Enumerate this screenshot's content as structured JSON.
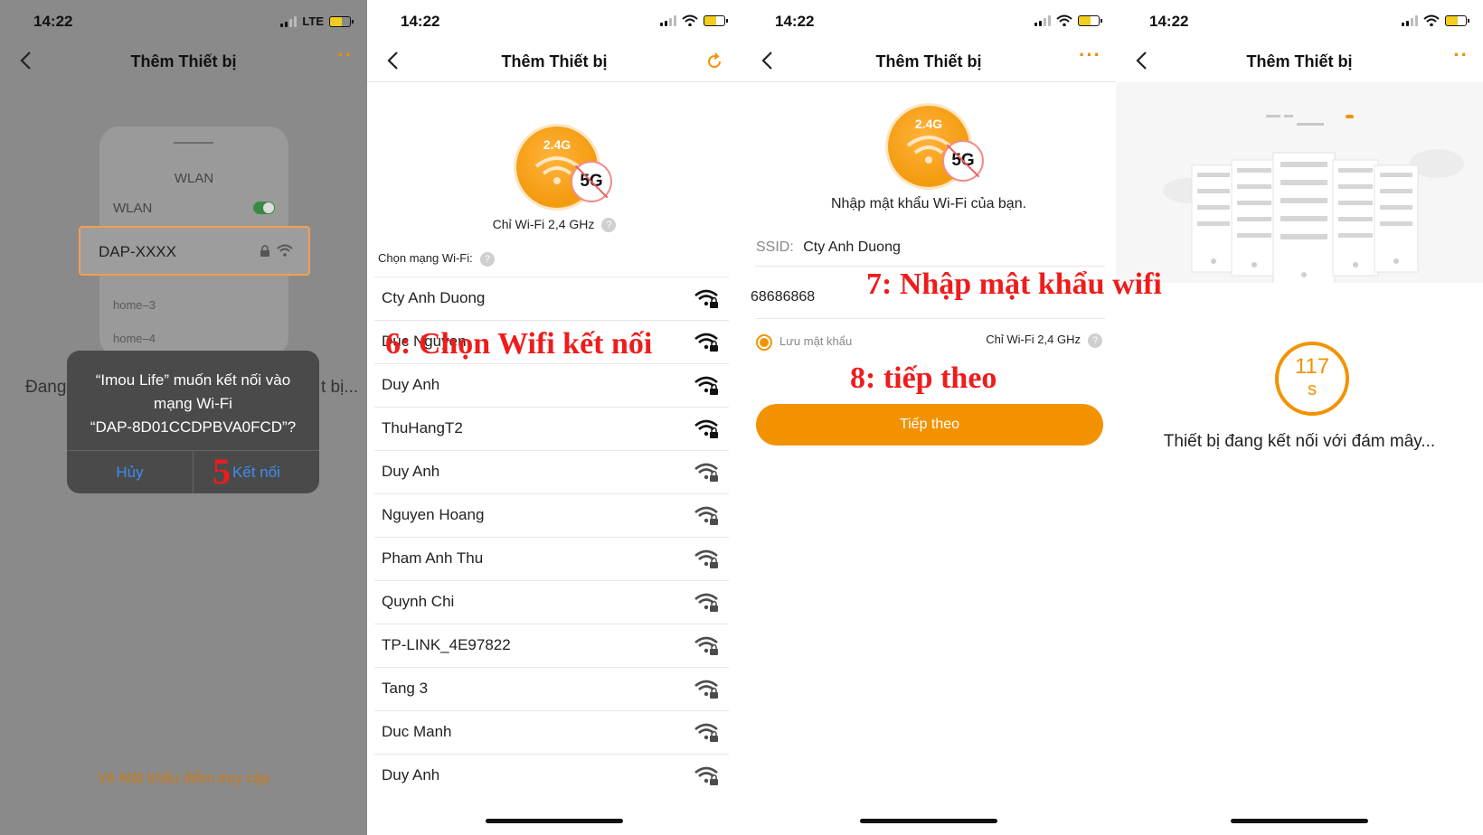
{
  "status_bar": {
    "time": "14:22",
    "carrier": "LTE"
  },
  "header": {
    "title": "Thêm Thiết bị"
  },
  "panel1": {
    "card_title": "WLAN",
    "wlan_label": "WLAN",
    "selected_network": "DAP-XXXX",
    "other_networks": [
      "home–3",
      "home–4"
    ],
    "partial_left": "Đang",
    "partial_right": "t bị...",
    "dialog": {
      "message_line1": "“Imou Life” muốn kết nối vào",
      "message_line2": "mạng Wi-Fi",
      "message_line3": "“DAP-8D01CCDPBVA0FCD”?",
      "cancel_label": "Hủy",
      "connect_label": "Kết nối"
    },
    "step_marker": "5",
    "footer_link": "Về Mật khẩu điểm truy cập"
  },
  "panel2": {
    "band_label": "2.4G",
    "band_5g": "5G",
    "caption": "Chỉ Wi-Fi 2,4 GHz",
    "choose_label": "Chọn mạng Wi-Fi:",
    "networks": [
      "Cty Anh Duong",
      "Duc Nguyen",
      "Duy Anh",
      "ThuHangT2",
      "Duy Anh",
      "Nguyen Hoang",
      "Pham Anh Thu",
      "Quynh Chi",
      "TP-LINK_4E97822",
      "Tang 3",
      "Duc Manh",
      "Duy Anh"
    ],
    "annotation": "6: Chọn Wifi kết nối"
  },
  "panel3": {
    "band_label": "2.4G",
    "band_5g": "5G",
    "prompt": "Nhập mật khẩu Wi-Fi của bạn.",
    "ssid_label": "SSID:",
    "ssid_value": "Cty Anh Duong",
    "password_value": "68686868",
    "save_password_label": "Lưu mật khẩu",
    "band_note": "Chỉ Wi-Fi 2,4 GHz",
    "next_button": "Tiếp theo",
    "annotation_password": "7: Nhập mật khẩu wifi",
    "annotation_next": "8: tiếp theo"
  },
  "panel4": {
    "countdown_value": "117",
    "countdown_unit": "s",
    "status_text": "Thiết bị đang kết nối với đám mây..."
  },
  "colors": {
    "accent": "#f39200",
    "annotation": "#ee1c1c",
    "ios_blue": "#3d8df0"
  }
}
